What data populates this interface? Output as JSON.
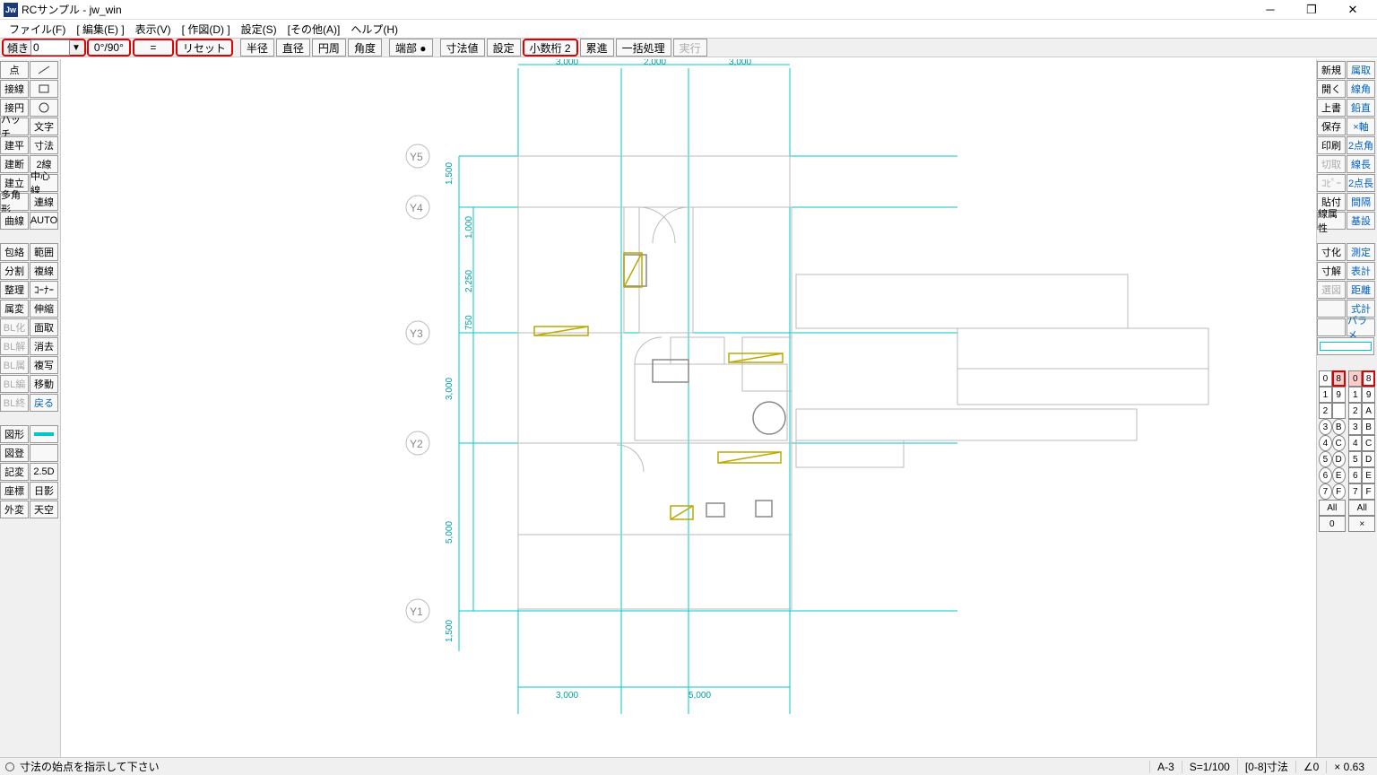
{
  "title": "RCサンプル - jw_win",
  "menu": [
    "ファイル(F)",
    "[ 編集(E) ]",
    "表示(V)",
    "[ 作図(D) ]",
    "設定(S)",
    "[その他(A)]",
    "ヘルプ(H)"
  ],
  "toolbar": {
    "angle_label": "傾き",
    "angle_value": "0",
    "btn_090": "0°/90°",
    "dash": "=",
    "reset": "リセット",
    "buttons": [
      "半径",
      "直径",
      "円周",
      "角度",
      "端部 ●",
      "寸法値",
      "設定",
      "小数桁 2",
      "累進",
      "一括処理",
      "実行"
    ]
  },
  "left_panel": {
    "col1": [
      "点",
      "接線",
      "接円",
      "ハッチ",
      "建平",
      "建断",
      "建立",
      "多角形",
      "曲線",
      "",
      "包絡",
      "分割",
      "整理",
      "属変",
      "BL化",
      "BL解",
      "BL属",
      "BL編",
      "BL終",
      "",
      "図形",
      "図登",
      "記変",
      "座標",
      "外変"
    ],
    "col2": [
      "/",
      "□",
      "○",
      "文字",
      "寸法",
      "2線",
      "中心線",
      "連線",
      "AUTO",
      "",
      "範囲",
      "複線",
      "ｺｰﾅｰ",
      "伸縮",
      "面取",
      "消去",
      "複写",
      "移動",
      "戻る",
      "",
      "",
      "",
      "2.5D",
      "日影",
      "天空"
    ]
  },
  "right_panel": {
    "col1": [
      "新規",
      "開く",
      "上書",
      "保存",
      "印刷",
      "切取",
      "ｺﾋﾟｰ",
      "貼付",
      "線属性",
      "",
      "寸化",
      "寸解",
      "選図",
      ""
    ],
    "col2": [
      "属取",
      "線角",
      "鉛直",
      "×軸",
      "2点角",
      "線長",
      "2点長",
      "間隔",
      "基設",
      "",
      "測定",
      "表計",
      "距離",
      "式計",
      "パラメ"
    ]
  },
  "layer": {
    "left_col": [
      "0",
      "1",
      "2",
      "3",
      "4",
      "5",
      "6",
      "7"
    ],
    "mid1": [
      "8",
      "9",
      "",
      "B",
      "C",
      "D",
      "E",
      "F"
    ],
    "mid2": [
      "0",
      "1",
      "2",
      "3",
      "4",
      "5",
      "6",
      "7"
    ],
    "right_col": [
      "8",
      "9",
      "A",
      "B",
      "C",
      "D",
      "E",
      "F"
    ],
    "all": "All",
    "zero": "0",
    "x": "×"
  },
  "drawing": {
    "dims_top": [
      "3,000",
      "2,000",
      "3,000"
    ],
    "dims_bottom": [
      "3,000",
      "5,000"
    ],
    "dims_left": [
      "1,500",
      "1,000",
      "2,250",
      "750",
      "3,000",
      "5,000",
      "1,500"
    ],
    "ylabels": [
      "Y5",
      "Y4",
      "Y3",
      "Y2",
      "Y1"
    ]
  },
  "status": {
    "msg": "寸法の始点を指示して下さい",
    "seg1": "A-3",
    "seg2": "S=1/100",
    "seg3": "[0-8]寸法",
    "seg4": "∠0",
    "seg5": "× 0.63"
  }
}
